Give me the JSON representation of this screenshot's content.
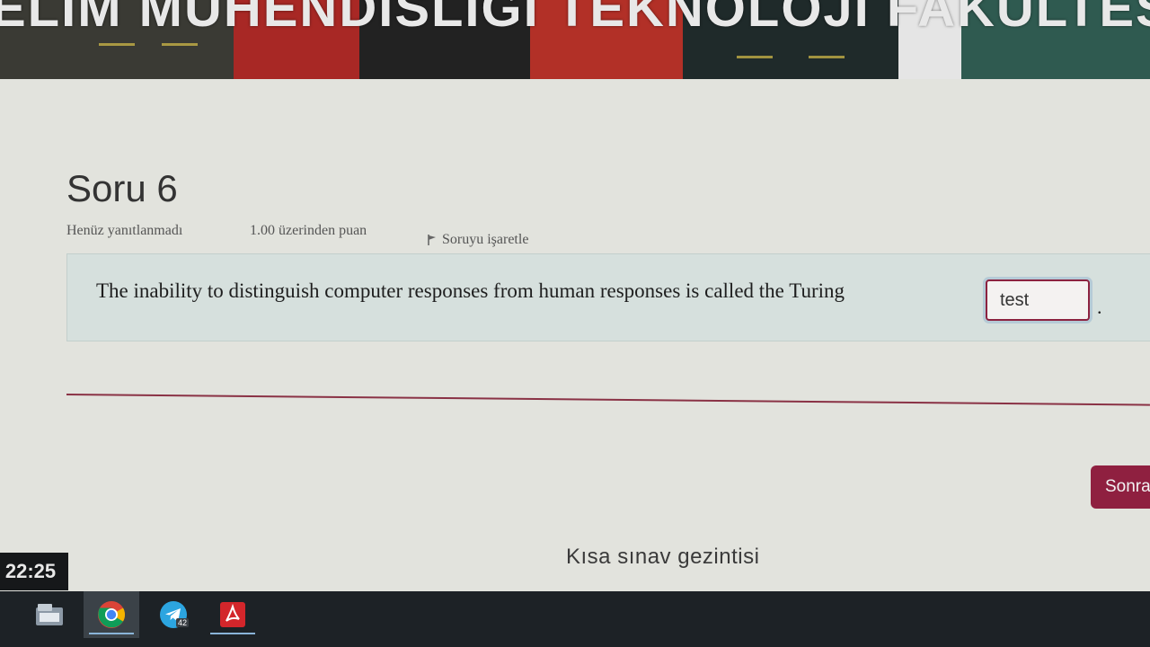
{
  "banner": {
    "title": "ELİM MÜHENDİSLİĞİ TEKNOLOJİ FAKÜLTESİ"
  },
  "question": {
    "title": "Soru 6",
    "status": "Henüz yanıtlanmadı",
    "points": "1.00 üzerinden puan",
    "flag_label": "Soruyu işaretle",
    "text": "The inability to distinguish computer responses from human responses is called the Turing",
    "answer_value": "test",
    "suffix": "."
  },
  "navigation": {
    "next_label": "Sonra",
    "quiz_nav_label": "Kısa sınav gezintisi"
  },
  "system": {
    "clock": "22:25",
    "telegram_badge": "42"
  },
  "taskbar": {
    "items": [
      {
        "icon": "explorer-icon"
      },
      {
        "icon": "chrome-icon",
        "active": true
      },
      {
        "icon": "telegram-icon"
      },
      {
        "icon": "acrobat-icon"
      }
    ]
  },
  "colors": {
    "accent": "#8f2040",
    "question_bg": "#d6e0dd",
    "taskbar": "#1d2226"
  }
}
